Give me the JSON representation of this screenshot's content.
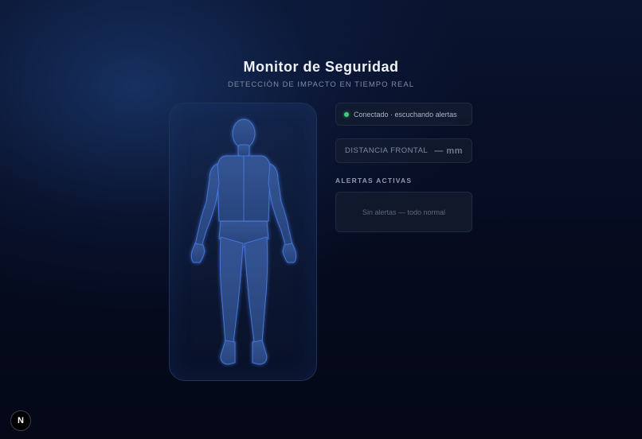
{
  "header": {
    "title": "Monitor de Seguridad",
    "subtitle": "DETECCIÓN DE IMPACTO EN TIEMPO REAL"
  },
  "status": {
    "text": "Conectado · escuchando alertas",
    "indicator_color": "#43c97a"
  },
  "distance": {
    "label": "DISTANCIA FRONTAL",
    "value": "— mm"
  },
  "alerts": {
    "heading": "ALERTAS ACTIVAS",
    "empty_text": "Sin alertas — todo normal"
  },
  "dev_badge": {
    "letter": "N"
  },
  "colors": {
    "background": "#060b1f",
    "body_fill": "#2a4a86",
    "body_stroke": "#3d6bd0"
  }
}
